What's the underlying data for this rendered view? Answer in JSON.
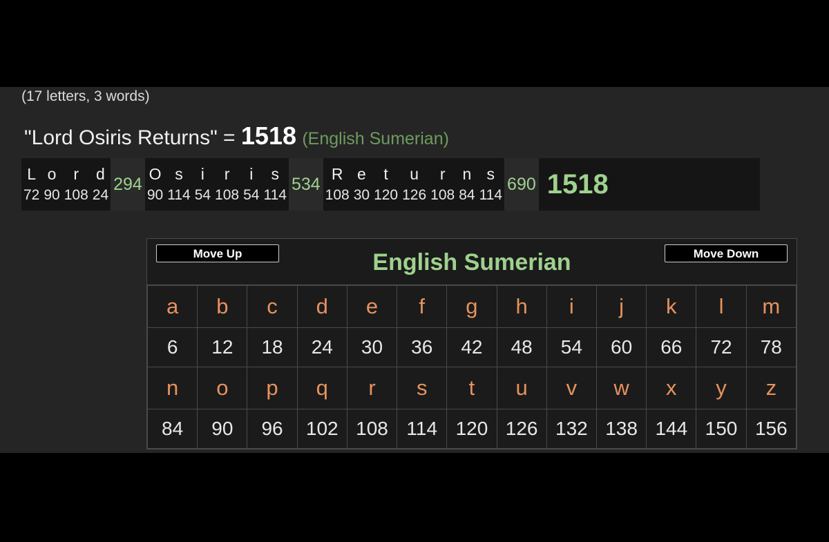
{
  "summary": "(17 letters, 3 words)",
  "phrase": {
    "text": "\"Lord Osiris Returns\" = ",
    "total": "1518",
    "cipher": "(English Sumerian)"
  },
  "breakdown": {
    "words": [
      {
        "letters": [
          "L",
          "o",
          "r",
          "d"
        ],
        "values": [
          "72",
          "90",
          "108",
          "24"
        ],
        "sum": "294"
      },
      {
        "letters": [
          "O",
          "s",
          "i",
          "r",
          "i",
          "s"
        ],
        "values": [
          "90",
          "114",
          "54",
          "108",
          "54",
          "114"
        ],
        "sum": "534"
      },
      {
        "letters": [
          "R",
          "e",
          "t",
          "u",
          "r",
          "n",
          "s"
        ],
        "values": [
          "108",
          "30",
          "120",
          "126",
          "108",
          "84",
          "114"
        ],
        "sum": "690"
      }
    ],
    "total": "1518"
  },
  "cipher_table": {
    "title": "English Sumerian",
    "move_up": "Move Up",
    "move_down": "Move Down",
    "rows": [
      {
        "letters": [
          "a",
          "b",
          "c",
          "d",
          "e",
          "f",
          "g",
          "h",
          "i",
          "j",
          "k",
          "l",
          "m"
        ],
        "values": [
          "6",
          "12",
          "18",
          "24",
          "30",
          "36",
          "42",
          "48",
          "54",
          "60",
          "66",
          "72",
          "78"
        ]
      },
      {
        "letters": [
          "n",
          "o",
          "p",
          "q",
          "r",
          "s",
          "t",
          "u",
          "v",
          "w",
          "x",
          "y",
          "z"
        ],
        "values": [
          "84",
          "90",
          "96",
          "102",
          "108",
          "114",
          "120",
          "126",
          "132",
          "138",
          "144",
          "150",
          "156"
        ]
      }
    ]
  },
  "colors": {
    "accent_green": "#9fd18e",
    "letter_orange": "#e7925d",
    "muted_green": "#6f9a5f"
  }
}
